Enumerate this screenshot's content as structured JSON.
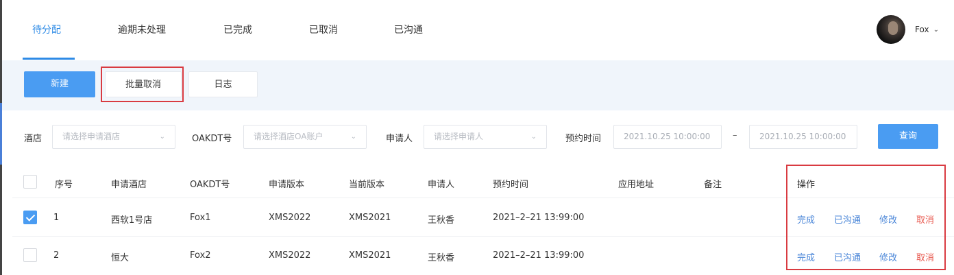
{
  "tabs": [
    {
      "label": "待分配",
      "active": true
    },
    {
      "label": "逾期未处理",
      "active": false
    },
    {
      "label": "已完成",
      "active": false
    },
    {
      "label": "已取消",
      "active": false
    },
    {
      "label": "已沟通",
      "active": false
    }
  ],
  "user": {
    "name": "Fox",
    "caret": "⌄"
  },
  "toolbar": {
    "new_label": "新建",
    "batch_cancel_label": "批量取消",
    "log_label": "日志"
  },
  "filters": {
    "hotel_label": "酒店",
    "hotel_placeholder": "请选择申请酒店",
    "oakdt_label": "OAKDT号",
    "oakdt_placeholder": "请选择酒店OA账户",
    "applicant_label": "申请人",
    "applicant_placeholder": "请选择申请人",
    "time_label": "预约时间",
    "time_start": "2021.10.25  10:00:00",
    "time_end": "2021.10.25  10:00:00",
    "range_dash": "–",
    "caret": "⌄",
    "query_label": "查询"
  },
  "table": {
    "headers": {
      "seq": "序号",
      "hotel": "申请酒店",
      "oakdt": "OAKDT号",
      "apply_version": "申请版本",
      "current_version": "当前版本",
      "applicant": "申请人",
      "time": "预约时间",
      "address": "应用地址",
      "remark": "备注",
      "ops": "操作"
    },
    "rows": [
      {
        "checked": true,
        "seq": "1",
        "hotel": "西软1号店",
        "oakdt": "Fox1",
        "apply_version": "XMS2022",
        "current_version": "XMS2021",
        "applicant": "王秋香",
        "time": "2021–2–21  13:99:00",
        "address": "",
        "remark": ""
      },
      {
        "checked": false,
        "seq": "2",
        "hotel": "恒大",
        "oakdt": "Fox2",
        "apply_version": "XMS2022",
        "current_version": "XMS2021",
        "applicant": "王秋香",
        "time": "2021–2–21  13:99:00",
        "address": "",
        "remark": ""
      }
    ],
    "actions": {
      "complete": "完成",
      "communicated": "已沟通",
      "edit": "修改",
      "cancel": "取消"
    }
  },
  "colors": {
    "primary": "#4a9cf2",
    "active_tab": "#2e8be6",
    "link_blue": "#4a86d8",
    "danger": "#e8594f",
    "highlight": "#d93b41",
    "toolbar_bg": "#f0f5fb"
  }
}
